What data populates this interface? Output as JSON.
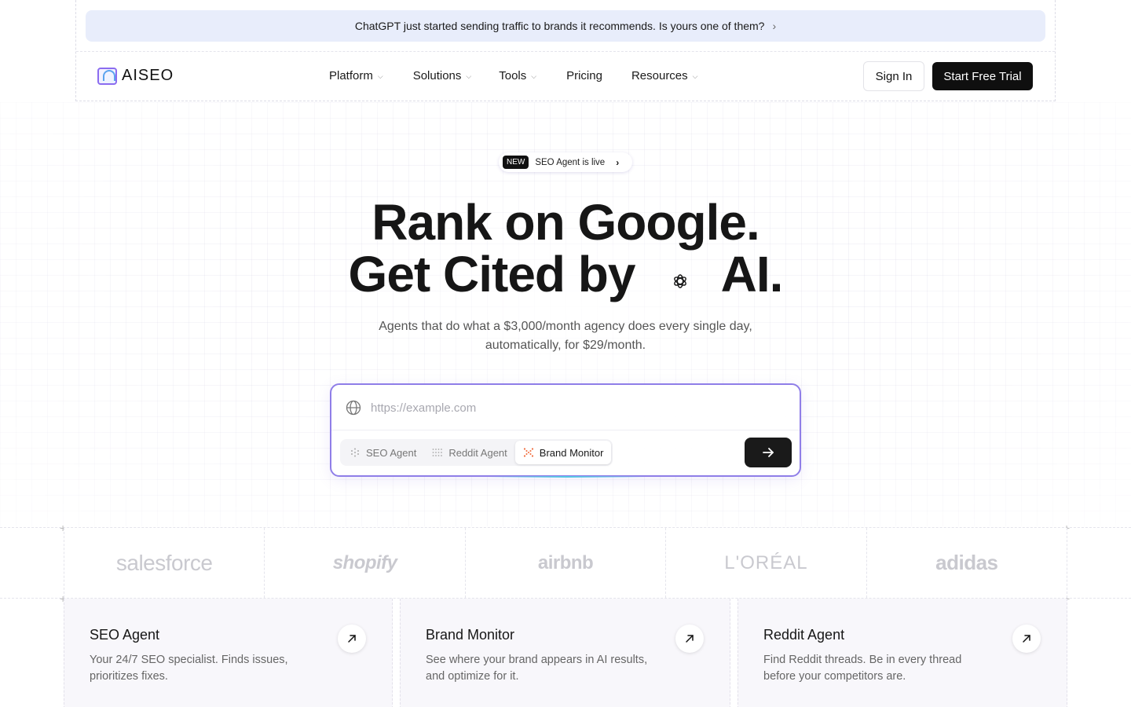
{
  "announcement": {
    "text": "ChatGPT just started sending traffic to brands it recommends. Is yours one of them?",
    "chevron": "›"
  },
  "nav": {
    "logo_text": "AISEO",
    "items": [
      {
        "label": "Platform",
        "has_dropdown": true
      },
      {
        "label": "Solutions",
        "has_dropdown": true
      },
      {
        "label": "Tools",
        "has_dropdown": true
      },
      {
        "label": "Pricing",
        "has_dropdown": false
      },
      {
        "label": "Resources",
        "has_dropdown": true
      }
    ],
    "sign_in": "Sign In",
    "cta": "Start Free Trial"
  },
  "hero": {
    "badge": "NEW",
    "badge_text": "SEO Agent is live",
    "headline_line1": "Rank on Google.",
    "headline_line2_a": "Get Cited by",
    "headline_line2_b": "AI.",
    "subtitle": "Agents that do what a $3,000/month agency does every single day, automatically, for $29/month."
  },
  "search": {
    "placeholder": "https://example.com",
    "value": "",
    "tabs": [
      {
        "label": "SEO Agent",
        "active": false,
        "icon": "dot-grid-icon"
      },
      {
        "label": "Reddit Agent",
        "active": false,
        "icon": "dot-rows-icon"
      },
      {
        "label": "Brand Monitor",
        "active": true,
        "icon": "scatter-icon"
      }
    ]
  },
  "logos": [
    "salesforce",
    "shopify",
    "airbnb",
    "L'ORÉAL",
    "adidas"
  ],
  "cards": [
    {
      "title": "SEO Agent",
      "desc": "Your 24/7 SEO specialist. Finds issues, prioritizes fixes."
    },
    {
      "title": "Brand Monitor",
      "desc": "See where your brand appears in AI results, and optimize for it."
    },
    {
      "title": "Reddit Agent",
      "desc": "Find Reddit threads. Be in every thread before your competitors are."
    }
  ],
  "colors": {
    "accent": "#8f7ee8",
    "announce_bg": "#e8edfb",
    "cta_bg": "#0f0f0f",
    "brand_tab_icon": "#f06a3a"
  }
}
